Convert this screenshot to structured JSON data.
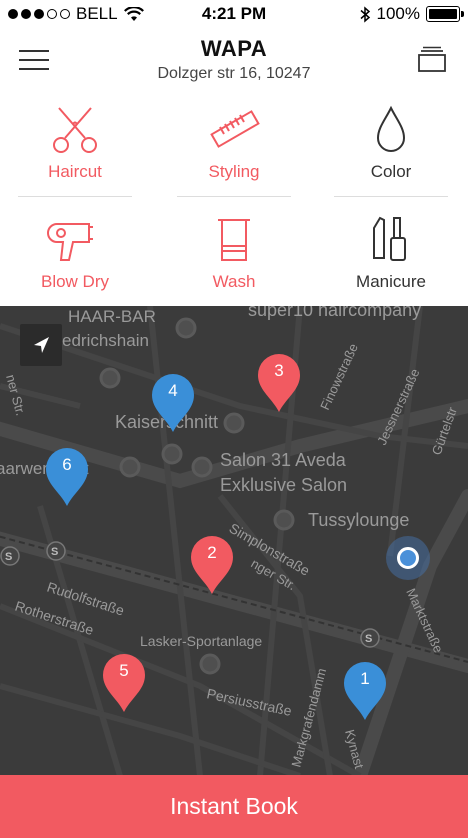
{
  "status": {
    "carrier": "BELL",
    "time": "4:21 PM",
    "battery": "100%"
  },
  "header": {
    "title": "WAPA",
    "address": "Dolzger str 16, 10247"
  },
  "services": [
    {
      "label": "Haircut",
      "icon": "scissors-icon",
      "color": "#f25a61"
    },
    {
      "label": "Styling",
      "icon": "comb-icon",
      "color": "#f25a61"
    },
    {
      "label": "Color",
      "icon": "drop-icon",
      "color": "#333333"
    },
    {
      "label": "Blow Dry",
      "icon": "hairdryer-icon",
      "color": "#f25a61"
    },
    {
      "label": "Wash",
      "icon": "towel-icon",
      "color": "#f25a61"
    },
    {
      "label": "Manicure",
      "icon": "nail-polish-icon",
      "color": "#333333"
    }
  ],
  "map": {
    "labels": [
      "HAAR-BAR",
      "edrichshain",
      "super10 haircompany",
      "Kaiserschnitt",
      "Salon 31 Aveda",
      "Exklusive Salon",
      "Tussylounge",
      "aarwerkstatt",
      "Lasker-Sportanlage",
      "Rudolfstraße",
      "Rotherstraße",
      "Persiusstraße",
      "Simplonstraße",
      "Finowstraße",
      "Jessnerstraße",
      "Gürtelstr",
      "Marktstraße",
      "Kynast",
      "Markgrafendamm",
      "ner Str.",
      "nger Str."
    ],
    "pins": [
      {
        "number": "1",
        "color": "#3a8fd8"
      },
      {
        "number": "2",
        "color": "#f25a61"
      },
      {
        "number": "3",
        "color": "#f25a61"
      },
      {
        "number": "4",
        "color": "#3a8fd8"
      },
      {
        "number": "5",
        "color": "#f25a61"
      },
      {
        "number": "6",
        "color": "#3a8fd8"
      }
    ]
  },
  "book_label": "Instant Book",
  "colors": {
    "accent": "#f25a61",
    "blue": "#3a8fd8",
    "map_bg": "#3b3b3b"
  }
}
